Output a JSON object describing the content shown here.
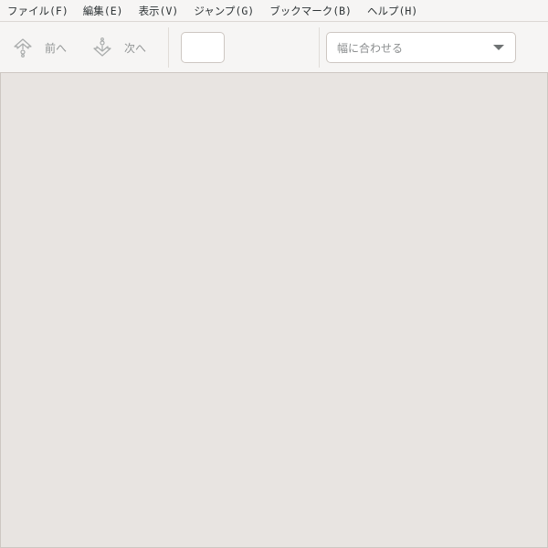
{
  "menubar": {
    "items": [
      {
        "label": "ファイル(F)"
      },
      {
        "label": "編集(E)"
      },
      {
        "label": "表示(V)"
      },
      {
        "label": "ジャンプ(G)"
      },
      {
        "label": "ブックマーク(B)"
      },
      {
        "label": "ヘルプ(H)"
      }
    ]
  },
  "toolbar": {
    "prev": {
      "label": "前へ",
      "icon": "go-up-icon"
    },
    "next": {
      "label": "次へ",
      "icon": "go-down-icon"
    },
    "page_entry": {
      "value": "",
      "placeholder": ""
    },
    "zoom": {
      "selected": "幅に合わせる"
    }
  },
  "colors": {
    "window_bg": "#f6f5f4",
    "doc_bg": "#e8e4e1",
    "border": "#cdc7c2",
    "disabled_text": "#929595",
    "text": "#2e3436"
  }
}
